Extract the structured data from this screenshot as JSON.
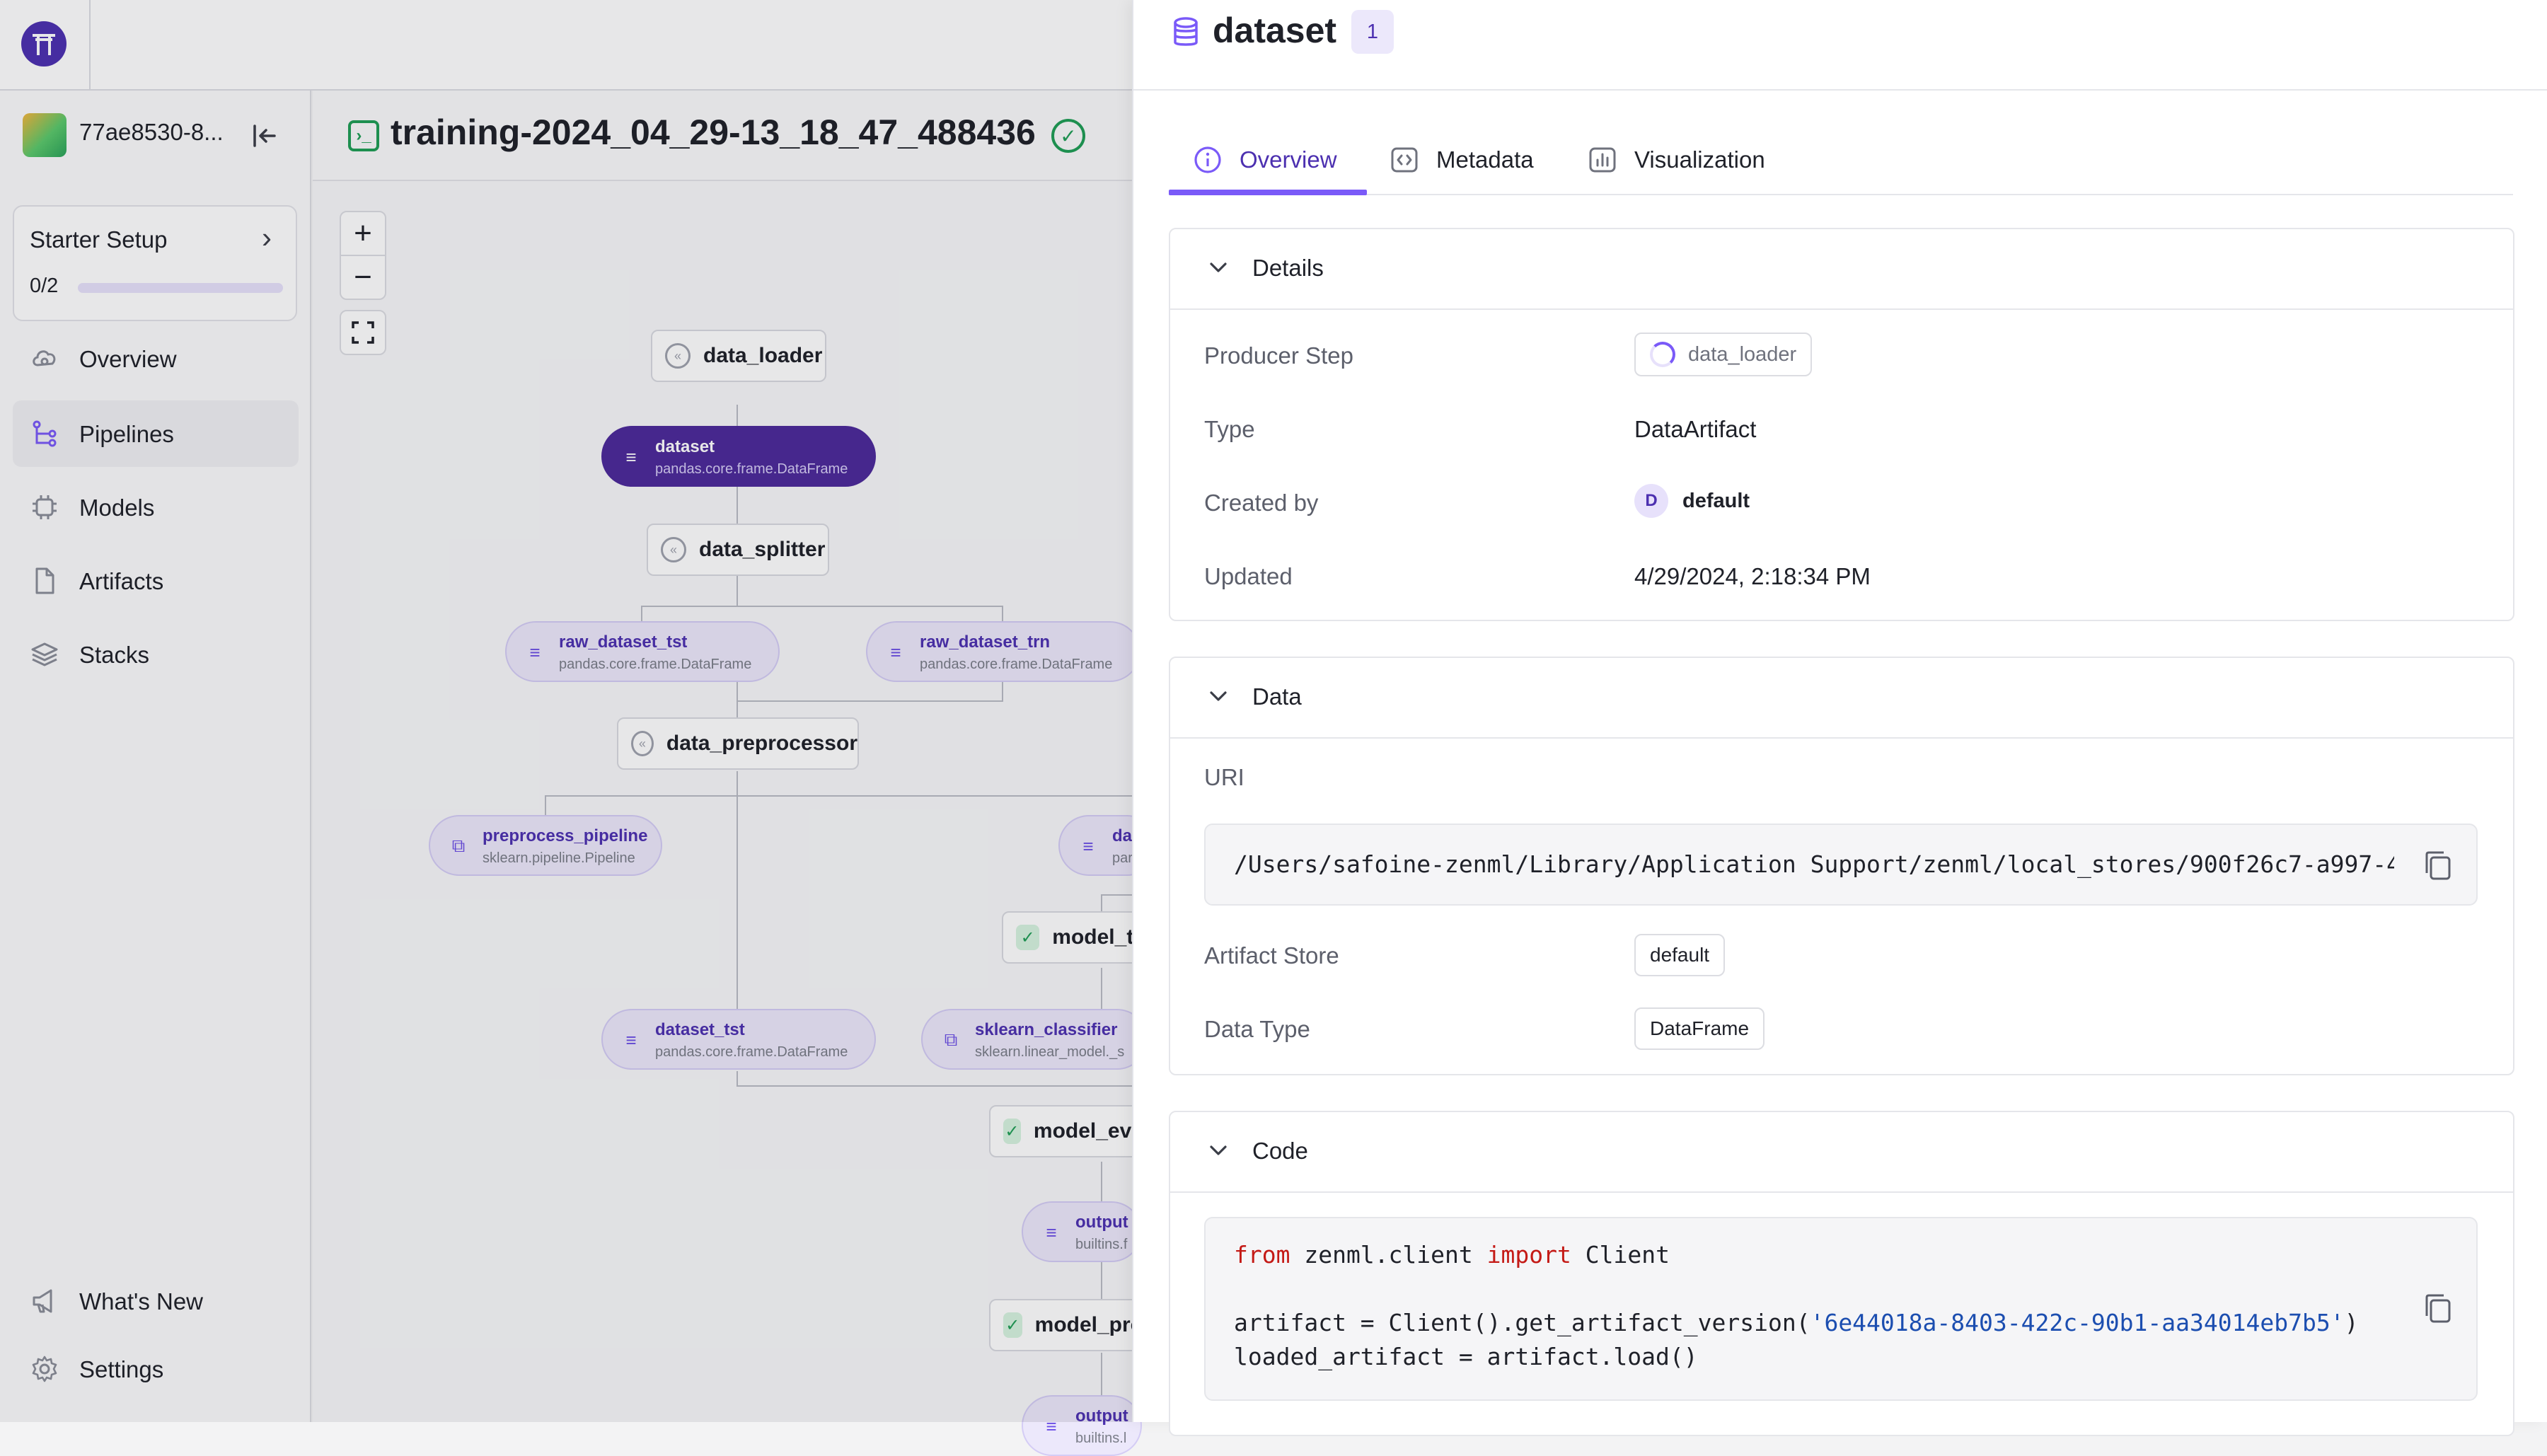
{
  "workspace": {
    "name": "77ae8530-8..."
  },
  "starter": {
    "title": "Starter Setup",
    "progress_text": "0/2",
    "progress_fraction": 0.0
  },
  "nav": {
    "items": [
      {
        "label": "Overview",
        "icon": "overview-icon"
      },
      {
        "label": "Pipelines",
        "icon": "pipelines-icon",
        "active": true
      },
      {
        "label": "Models",
        "icon": "models-icon"
      },
      {
        "label": "Artifacts",
        "icon": "artifacts-icon"
      },
      {
        "label": "Stacks",
        "icon": "stacks-icon"
      }
    ],
    "bottom": [
      {
        "label": "What's New",
        "icon": "megaphone-icon"
      },
      {
        "label": "Settings",
        "icon": "gear-icon"
      }
    ]
  },
  "run": {
    "title": "training-2024_04_29-13_18_47_488436",
    "status": "completed"
  },
  "dag": {
    "steps": [
      "data_loader",
      "data_splitter",
      "data_preprocessor",
      "model_tr",
      "model_eva",
      "model_pro"
    ],
    "artifacts": [
      {
        "name": "dataset",
        "type": "pandas.core.frame.DataFrame"
      },
      {
        "name": "raw_dataset_tst",
        "type": "pandas.core.frame.DataFrame"
      },
      {
        "name": "raw_dataset_trn",
        "type": "pandas.core.frame.DataFrame"
      },
      {
        "name": "preprocess_pipeline",
        "type": "sklearn.pipeline.Pipeline"
      },
      {
        "name": "da",
        "type": "par"
      },
      {
        "name": "dataset_tst",
        "type": "pandas.core.frame.DataFrame"
      },
      {
        "name": "sklearn_classifier",
        "type": "sklearn.linear_model._s"
      },
      {
        "name": "output",
        "type": "builtins.f"
      },
      {
        "name": "output",
        "type": "builtins.l"
      }
    ]
  },
  "panel": {
    "title": "dataset",
    "version": "1",
    "tabs": [
      {
        "label": "Overview",
        "icon": "info-icon",
        "active": true
      },
      {
        "label": "Metadata",
        "icon": "code-brackets-icon"
      },
      {
        "label": "Visualization",
        "icon": "bar-chart-icon"
      }
    ],
    "details": {
      "title": "Details",
      "producer_step_label": "Producer Step",
      "producer_step": "data_loader",
      "type_label": "Type",
      "type": "DataArtifact",
      "created_by_label": "Created by",
      "created_by_initial": "D",
      "created_by": "default",
      "updated_label": "Updated",
      "updated": "4/29/2024, 2:18:34 PM"
    },
    "data": {
      "title": "Data",
      "uri_label": "URI",
      "uri": "/Users/safoine-zenml/Library/Application Support/zenml/local_stores/900f26c7-a997-4…",
      "artifact_store_label": "Artifact Store",
      "artifact_store": "default",
      "data_type_label": "Data Type",
      "data_type": "DataFrame"
    },
    "code": {
      "title": "Code",
      "l1_kw1": "from",
      "l1_mod": " zenml.client ",
      "l1_kw2": "import",
      "l1_name": " Client",
      "l2_pre": "artifact = Client().get_artifact_version(",
      "l2_str": "'6e44018a-8403-422c-90b1-aa34014eb7b5'",
      "l2_post": ")",
      "l3": "loaded_artifact = artifact.load()"
    }
  }
}
